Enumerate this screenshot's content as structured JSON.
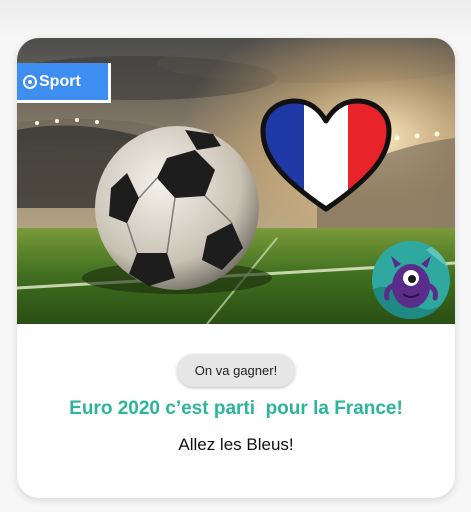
{
  "category_badge": {
    "label": "Sport",
    "icon": "target-icon",
    "color": "#3d8ef0"
  },
  "hero": {
    "image": "soccer-ball-stadium-illustration",
    "heart_icon": "france-flag-heart-icon",
    "avatar_icon": "purple-monster-avatar-icon",
    "flag_colors": [
      "#1f3aa6",
      "#ffffff",
      "#e8232a"
    ]
  },
  "card": {
    "chip_label": "On va gagner!",
    "title": "Euro 2020 c’est parti  pour la France!",
    "subtitle": "Allez les Bleus!",
    "accent_color": "#2bb59a"
  }
}
